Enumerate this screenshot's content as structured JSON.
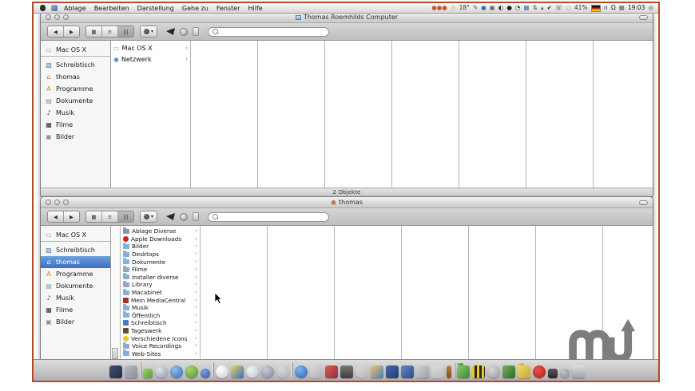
{
  "menu_bar": {
    "menus": [
      {
        "label": "Ablage"
      },
      {
        "label": "Bearbeiten"
      },
      {
        "label": "Darstellung"
      },
      {
        "label": "Gehe zu"
      },
      {
        "label": "Fenster"
      },
      {
        "label": "Hilfe"
      }
    ],
    "status_items": [
      {
        "name": "status-cluster-icon",
        "t": "●●●",
        "c": "#c05838"
      },
      {
        "name": "weather-icon",
        "t": "☼",
        "c": "#d89010"
      },
      {
        "name": "temperature-reading",
        "t": "18°",
        "c": "#333333"
      },
      {
        "name": "pencil-icon",
        "t": "✎",
        "c": "#555555"
      },
      {
        "name": "blue-dot-icon",
        "t": "●",
        "c": "#3a6fc4"
      },
      {
        "name": "display-icon",
        "t": "▣",
        "c": "#5a5a5a"
      },
      {
        "name": "half-moon-icon",
        "t": "◐",
        "c": "#333333"
      },
      {
        "name": "black-dot-icon",
        "t": "●",
        "c": "#1a1a1a"
      },
      {
        "name": "timer-icon",
        "t": "◔",
        "c": "#444444"
      },
      {
        "name": "grid-icon",
        "t": "▦",
        "c": "#3a5fa4"
      },
      {
        "name": "sync-icon",
        "t": "⇅",
        "c": "#555555"
      },
      {
        "name": "eject-icon",
        "t": "▴",
        "c": "#555555"
      },
      {
        "name": "check-icon",
        "t": "✔",
        "c": "#222222"
      },
      {
        "name": "phone-icon",
        "t": "☏",
        "c": "#333333"
      },
      {
        "name": "empty-circle-icon",
        "t": "○",
        "c": "#888888"
      },
      {
        "name": "battery-percent",
        "t": "41%",
        "c": "#333333"
      },
      {
        "name": "german-flag-icon",
        "t": "",
        "cls": "flag"
      },
      {
        "name": "headphones-icon",
        "t": "∩",
        "c": "#222222"
      },
      {
        "name": "omega-icon",
        "t": "Ω",
        "c": "#222222"
      },
      {
        "name": "calendar-icon",
        "t": "▦",
        "c": "#555555"
      },
      {
        "name": "menubar-clock",
        "t": "19:03",
        "c": "#111111"
      },
      {
        "name": "spotlight-icon",
        "t": "◎",
        "c": "#334488"
      }
    ]
  },
  "toolbar": {
    "back_glyph": "◀",
    "forward_glyph": "▶",
    "view_icon_glyph": "▦",
    "view_list_glyph": "≡",
    "view_column_glyph": "|||",
    "action_caret": "▾",
    "search_placeholder": ""
  },
  "window1": {
    "title": "Thomas Roemhilds Computer",
    "status_text": "2 Objekte",
    "sidebar": [
      {
        "label": "Mac OS X",
        "g": "▭",
        "c": "#9aa2ae",
        "cls": "top"
      },
      {
        "label": "Schreibtisch",
        "g": "▨",
        "c": "#4a7ac8"
      },
      {
        "label": "thomas",
        "g": "⌂",
        "c": "#c87840"
      },
      {
        "label": "Programme",
        "g": "A",
        "c": "#c89028"
      },
      {
        "label": "Dokumente",
        "g": "▤",
        "c": "#8898a8"
      },
      {
        "label": "Musik",
        "g": "♪",
        "c": "#444444"
      },
      {
        "label": "Filme",
        "g": "▦",
        "c": "#303030"
      },
      {
        "label": "Bilder",
        "g": "▣",
        "c": "#8890a0"
      }
    ],
    "column1": [
      {
        "label": "Mac OS X",
        "g": "▭",
        "c": "#9aa2ae"
      },
      {
        "label": "Netzwerk",
        "g": "◉",
        "c": "#4a7ac8"
      }
    ]
  },
  "window2": {
    "title": "thomas",
    "sidebar": [
      {
        "label": "Mac OS X",
        "g": "▭",
        "c": "#9aa2ae",
        "cls": "top"
      },
      {
        "label": "Schreibtisch",
        "g": "▨",
        "c": "#4a7ac8"
      },
      {
        "label": "thomas",
        "g": "⌂",
        "c": "#ffffff",
        "cls": "sel"
      },
      {
        "label": "Programme",
        "g": "A",
        "c": "#c89028"
      },
      {
        "label": "Dokumente",
        "g": "▤",
        "c": "#8898a8"
      },
      {
        "label": "Musik",
        "g": "♪",
        "c": "#444444"
      },
      {
        "label": "Filme",
        "g": "▦",
        "c": "#303030"
      },
      {
        "label": "Bilder",
        "g": "▣",
        "c": "#8890a0"
      }
    ],
    "column1": [
      {
        "label": "Ablage Diverse",
        "c": "#8a92a2",
        "shape": "folder"
      },
      {
        "label": "Apple Downloads",
        "c": "#cc2222",
        "shape": "circle"
      },
      {
        "label": "Bilder",
        "c": "#84aede",
        "shape": "folder"
      },
      {
        "label": "Desktops",
        "c": "#84aede",
        "shape": "folder"
      },
      {
        "label": "Dokumente",
        "c": "#84aede",
        "shape": "folder"
      },
      {
        "label": "Filme",
        "c": "#9aa6b6",
        "shape": "folder"
      },
      {
        "label": "Installer diverse",
        "c": "#84aede",
        "shape": "folder"
      },
      {
        "label": "Library",
        "c": "#9aa6b6",
        "shape": "folder"
      },
      {
        "label": "Macabinet",
        "c": "#84aede",
        "shape": "folder"
      },
      {
        "label": "Mein MediaCentral",
        "c": "#a83028",
        "shape": "square"
      },
      {
        "label": "Musik",
        "c": "#84aede",
        "shape": "folder"
      },
      {
        "label": "Öffentlich",
        "c": "#84aede",
        "shape": "folder"
      },
      {
        "label": "Schreibtisch",
        "c": "#4878c8",
        "shape": "square"
      },
      {
        "label": "Tageswerk",
        "c": "#6a4a38",
        "shape": "square"
      },
      {
        "label": "Verschiedene Icons",
        "c": "#e8c820",
        "shape": "circle"
      },
      {
        "label": "Voice Recordings",
        "c": "#84aede",
        "shape": "folder"
      },
      {
        "label": "Web-Sites",
        "c": "#84aede",
        "shape": "folder"
      }
    ]
  },
  "dock": {
    "items": [
      {
        "name": "finder-icon",
        "cls": "ic",
        "bg": "linear-gradient(135deg,#44506e,#222c44)"
      },
      {
        "name": "app-icon",
        "cls": "ic",
        "bg": "linear-gradient(135deg,#b8bcc2,#888e96)"
      },
      {
        "name": "dock-divider",
        "cls": "sep"
      },
      {
        "name": "app-icon",
        "cls": "sm",
        "bg": "linear-gradient(135deg,#9ed06a,#5a9a34)"
      },
      {
        "name": "app-icon",
        "cls": "rnd",
        "bg": "radial-gradient(circle at 35% 30%,#e0e4ea,#9098a4)"
      },
      {
        "name": "browser-icon",
        "cls": "rnd",
        "bg": "radial-gradient(circle at 35% 30%,#8ec0ea,#2e6cb0)"
      },
      {
        "name": "app-icon",
        "cls": "rnd",
        "bg": "radial-gradient(circle at 35% 30%,#a8d870,#4e8c2e)"
      },
      {
        "name": "app-icon",
        "cls": "rnd sm",
        "bg": "radial-gradient(circle at 35% 30%,#78a0e0,#3058a8)"
      },
      {
        "name": "dock-divider",
        "cls": "sep"
      },
      {
        "name": "app-icon",
        "cls": "rnd",
        "bg": "radial-gradient(circle at 35% 30%,#ffffff,#c8ccd2)"
      },
      {
        "name": "app-icon",
        "cls": "ic",
        "bg": "linear-gradient(135deg,#e8d860,#3a6ab8)"
      },
      {
        "name": "app-icon",
        "cls": "rnd",
        "bg": "radial-gradient(circle at 35% 30%,#f4f4f4,#b8bcc4)"
      },
      {
        "name": "app-icon",
        "cls": "rnd",
        "bg": "radial-gradient(circle at 35% 30%,#c8ced6,#7e8692)"
      },
      {
        "name": "app-icon",
        "cls": "rnd dim",
        "bg": "radial-gradient(circle at 35% 30%,#e8eaee,#a0a6b0)"
      },
      {
        "name": "dock-divider",
        "cls": "sep"
      },
      {
        "name": "chat-icon",
        "cls": "rnd",
        "bg": "radial-gradient(circle at 35% 30%,#7ab4f0,#2a62b8)"
      },
      {
        "name": "app-icon",
        "cls": "dim",
        "bg": "linear-gradient(135deg,#e0e0e0,#b0b0b0)"
      },
      {
        "name": "app-icon",
        "cls": "ic",
        "bg": "linear-gradient(135deg,#e06040,#8c2c4e)"
      },
      {
        "name": "app-icon",
        "cls": "ic",
        "bg": "linear-gradient(180deg,#787878,#3c3c3c)"
      },
      {
        "name": "app-icon",
        "cls": "rnd dim",
        "bg": "linear-gradient(135deg,#e4e4e4,#bcbcbc)"
      },
      {
        "name": "app-icon",
        "cls": "ic",
        "bg": "linear-gradient(135deg,#f0c860,#4878c0)"
      },
      {
        "name": "app-icon",
        "cls": "ic",
        "bg": "linear-gradient(135deg,#4868a8,#203c74)"
      },
      {
        "name": "app-icon",
        "cls": "ic",
        "bg": "linear-gradient(135deg,#6888c0,#2c4c8c)"
      },
      {
        "name": "app-icon",
        "cls": "ic",
        "bg": "linear-gradient(135deg,#d0d4da,#989ea8)"
      },
      {
        "name": "app-icon",
        "cls": "dim",
        "bg": "linear-gradient(135deg,#e8e8e8,#c0c0c0)"
      },
      {
        "name": "app-icon",
        "cls": "thin",
        "bg": "linear-gradient(180deg,#c08040,#7c4c18)"
      },
      {
        "name": "dock-divider",
        "cls": "sep"
      },
      {
        "name": "folder-icon",
        "cls": "fold",
        "bg": "linear-gradient(135deg,#8cc86c,#3e8838)"
      },
      {
        "name": "app-icon",
        "cls": "ic",
        "bg": "repeating-linear-gradient(90deg,#e8c820 0 3px,#282828 3px 6px)"
      },
      {
        "name": "app-icon",
        "cls": "rnd",
        "bg": "radial-gradient(circle at 35% 30%,#d8d8d8,#989898)"
      },
      {
        "name": "app-icon",
        "cls": "ic",
        "bg": "linear-gradient(135deg,#78b058,#2e6a28)"
      },
      {
        "name": "folder-icon",
        "cls": "fold",
        "bg": "linear-gradient(135deg,#f0d868,#c8a830)"
      },
      {
        "name": "download-badge-icon",
        "cls": "rnd",
        "bg": "radial-gradient(circle at 40% 35%,#f05048,#a81818)"
      },
      {
        "name": "app-icon",
        "cls": "sm",
        "bg": "linear-gradient(180deg,#585858,#282828)"
      },
      {
        "name": "app-icon",
        "cls": "rnd sm",
        "bg": "radial-gradient(circle at 35% 30%,#c4c4c4,#8a8a8a)"
      },
      {
        "name": "trash-icon",
        "cls": "ic",
        "bg": "linear-gradient(180deg,#dde0e4,#9aa0a8)"
      }
    ]
  },
  "watermark": {
    "text": "mu",
    "color": "#7d7d7d"
  }
}
